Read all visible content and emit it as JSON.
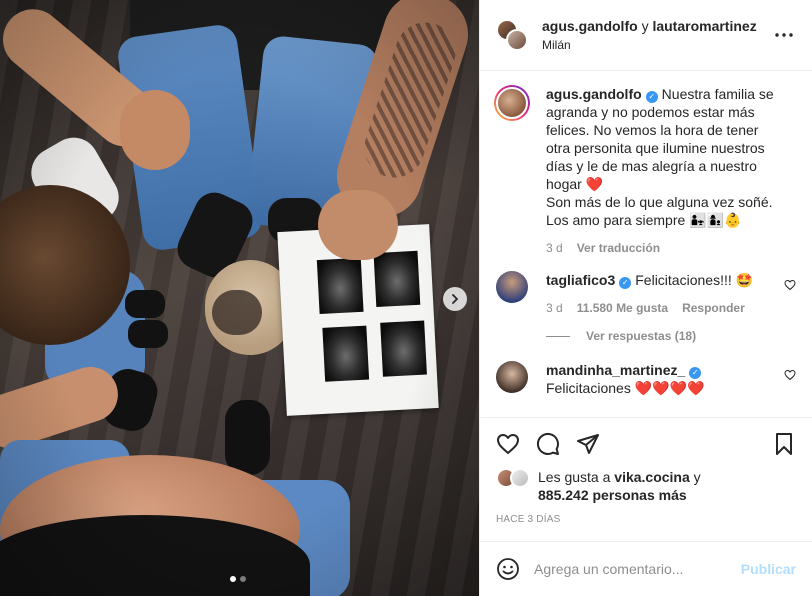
{
  "header": {
    "user1": "agus.gandolfo",
    "conj": "y",
    "user2": "lautaromartinez",
    "location": "Milán"
  },
  "caption": {
    "user": "agus.gandolfo",
    "text": "Nuestra familia se agranda y no podemos estar más felices. No vemos la hora de tener otra personita que ilumine nuestros días y le de mas alegría a nuestro hogar",
    "heart": "❤️",
    "text2": "Son más de lo que alguna vez soñé. Los amo para siempre",
    "emojis": "👨‍👧👩‍👦👶",
    "time": "3 d",
    "translate": "Ver traducción"
  },
  "comments": [
    {
      "user": "tagliafico3",
      "text": "Felicitaciones!!!",
      "emoji": "🤩",
      "time": "3 d",
      "likes": "11.580 Me gusta",
      "reply": "Responder"
    },
    {
      "user": "mandinha_martinez_",
      "text": "Felicitaciones",
      "hearts": "❤️❤️❤️❤️"
    }
  ],
  "replies": "Ver respuestas (18)",
  "likes": {
    "prefix": "Les gusta a",
    "user": "vika.cocina",
    "conj": "y",
    "count": "885.242 personas más"
  },
  "posted": "HACE 3 DÍAS",
  "comment_box": {
    "placeholder": "Agrega un comentario...",
    "publish": "Publicar"
  },
  "carousel": {
    "current": 1,
    "total": 2
  },
  "colors": {
    "verified": "#3897f0",
    "publish": "#b2dffc",
    "muted": "#8e8e8e"
  },
  "icons": [
    "more-options-icon",
    "verified-icon",
    "heart-outline-icon",
    "comment-icon",
    "share-icon",
    "bookmark-icon",
    "emoji-icon",
    "carousel-next-icon"
  ]
}
